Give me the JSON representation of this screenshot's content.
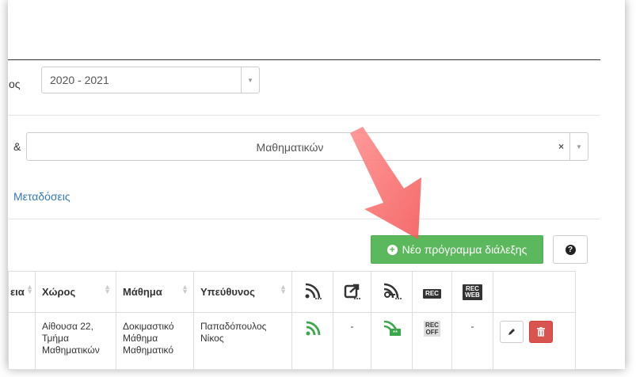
{
  "academic_year": {
    "label_fragment": "ος",
    "value": "2020 - 2021"
  },
  "department": {
    "label_fragment": "&",
    "value": "Μαθηματικών",
    "clear": "×"
  },
  "broadcasts_link": "Μεταδόσεις",
  "new_schedule_button": "Νέο πρόγραμμα διάλεξης",
  "help_button": "?",
  "table": {
    "headers": [
      "εια",
      "Χώρος",
      "Μάθημα",
      "Υπεύθυνος"
    ],
    "rows": [
      {
        "room": [
          "Αίθουσα 22,",
          "Τμήμα",
          "Μαθηματικών"
        ],
        "course": [
          "Δοκιμαστικό",
          "Μάθημα",
          "Μαθηματικό"
        ],
        "responsible": [
          "Παπαδόπουλος",
          "Νίκος"
        ],
        "upload": "-",
        "web_rec": "-",
        "rec_off_top": "REC",
        "rec_off_bottom": "OFF"
      }
    ],
    "rec_header": "REC",
    "rec_web_header_top": "REC",
    "rec_web_header_bottom": "WEB"
  },
  "colors": {
    "green": "#5cb85c",
    "red": "#d9534f",
    "arrow": "#f26b6b",
    "link": "#337ab7"
  },
  "icons": [
    "rss-icon",
    "share-icon",
    "key-rss-icon",
    "rec-icon",
    "rec-web-icon",
    "pencil-icon",
    "trash-icon",
    "plus-circle-icon",
    "question-circle-icon"
  ]
}
